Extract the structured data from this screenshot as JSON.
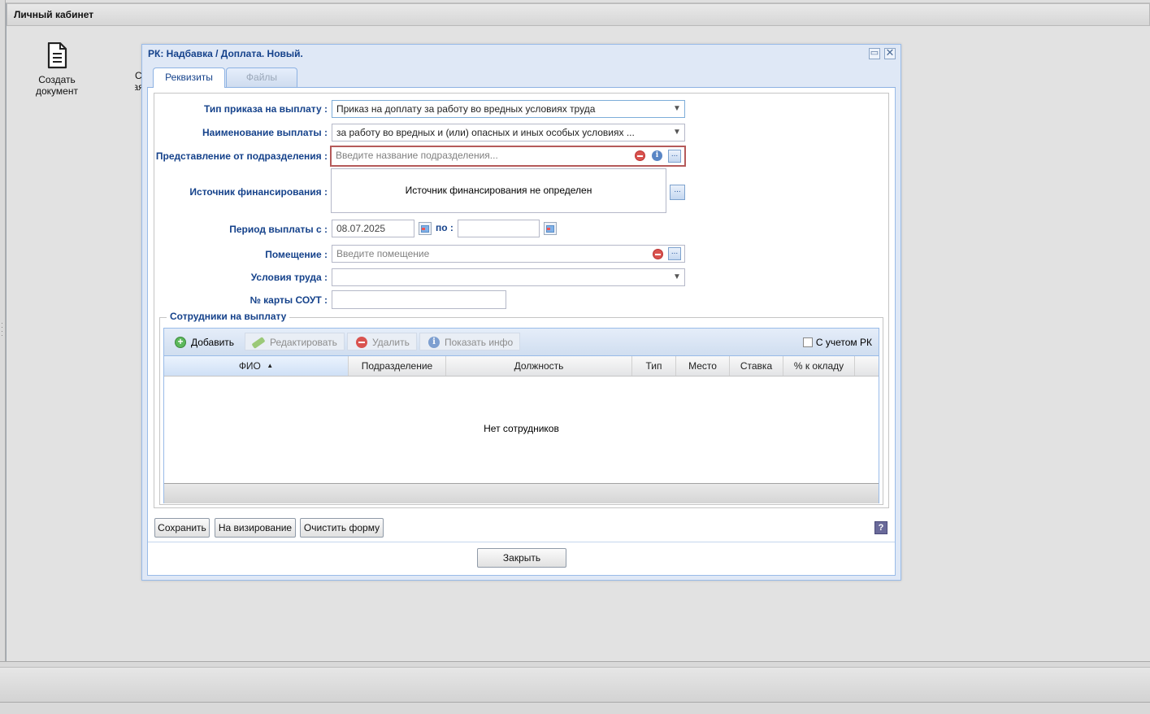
{
  "app": {
    "title": "Личный кабинет"
  },
  "desktop": {
    "create_document": {
      "line1": "Создать",
      "line2": "документ"
    },
    "second_shortcut": {
      "line1": "С",
      "line2": "зая"
    }
  },
  "dialog": {
    "title": "РК: Надбавка / Доплата. Новый.",
    "tabs": [
      "Реквизиты",
      "Файлы"
    ],
    "fields": {
      "order_type": {
        "label": "Тип приказа на выплату :",
        "value": "Приказ на доплату за работу во вредных условиях труда"
      },
      "payment_name": {
        "label": "Наименование выплаты :",
        "value": "за работу во вредных и (или) опасных и иных особых условиях ..."
      },
      "department": {
        "label": "Представление от подразделения :",
        "placeholder": "Введите название подразделения..."
      },
      "funding": {
        "label": "Источник финансирования :",
        "value": "Источник финансирования не определен"
      },
      "period": {
        "label": "Период выплаты с :",
        "from": "08.07.2025",
        "to_label": "по :",
        "to": ""
      },
      "room": {
        "label": "Помещение :",
        "placeholder": "Введите помещение"
      },
      "work_conditions": {
        "label": "Условия труда :",
        "value": ""
      },
      "sout_card": {
        "label": "№ карты СОУТ :",
        "value": ""
      }
    },
    "employees": {
      "legend": "Сотрудники на выплату",
      "toolbar": {
        "add": "Добавить",
        "edit": "Редактировать",
        "delete": "Удалить",
        "show_info": "Показать инфо",
        "with_rk": "С учетом РК"
      },
      "columns": [
        "ФИО",
        "Подразделение",
        "Должность",
        "Тип",
        "Место",
        "Ставка",
        "% к окладу"
      ],
      "empty_text": "Нет сотрудников"
    },
    "buttons": {
      "save": "Сохранить",
      "to_approval": "На визирование",
      "clear_form": "Очистить форму",
      "close": "Закрыть",
      "help": "?"
    }
  }
}
